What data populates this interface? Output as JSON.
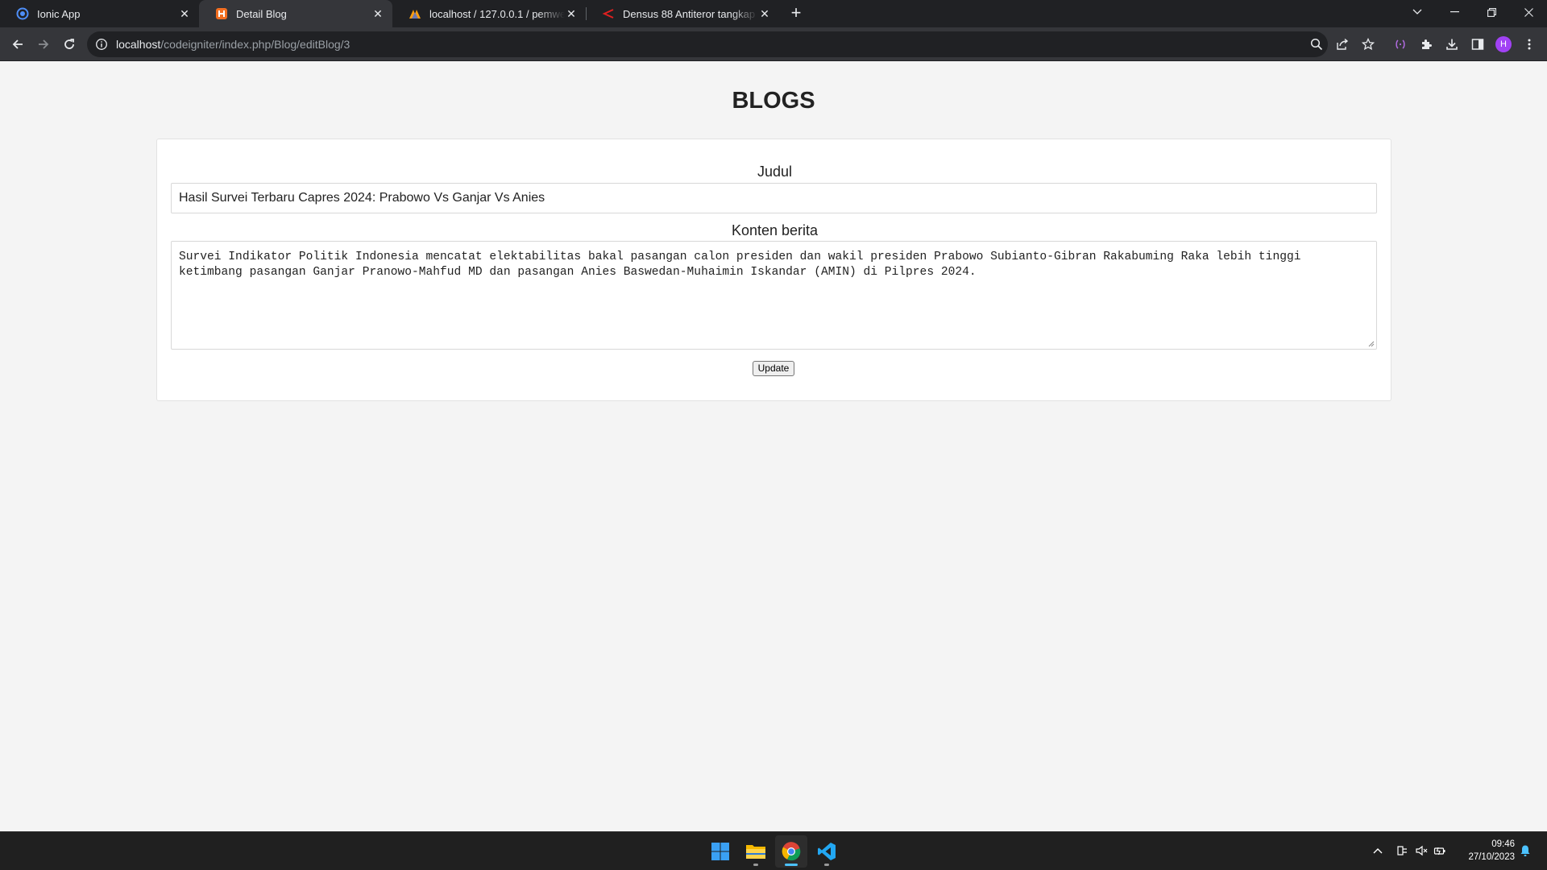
{
  "browser": {
    "tabs": [
      {
        "title": "Ionic App",
        "icon": "ionic-icon",
        "active": false
      },
      {
        "title": "Detail Blog",
        "icon": "codeigniter-icon",
        "active": true
      },
      {
        "title": "localhost / 127.0.0.1 / pemweb /",
        "icon": "phpmyadmin-icon",
        "active": false
      },
      {
        "title": "Densus 88 Antiteror tangkap 18",
        "icon": "news-icon",
        "active": false
      }
    ],
    "address": {
      "host": "localhost",
      "path": "/codeigniter/index.php/Blog/editBlog/3"
    },
    "profile_initial": "H",
    "accent_color": "#a142f4"
  },
  "page": {
    "title": "BLOGS",
    "form": {
      "judul_label": "Judul",
      "judul_value": "Hasil Survei Terbaru Capres 2024: Prabowo Vs Ganjar Vs Anies",
      "konten_label": "Konten berita",
      "konten_value": "Survei Indikator Politik Indonesia mencatat elektabilitas bakal pasangan calon presiden dan wakil presiden Prabowo Subianto-Gibran Rakabuming Raka lebih tinggi\nketimbang pasangan Ganjar Pranowo-Mahfud MD dan pasangan Anies Baswedan-Muhaimin Iskandar (AMIN) di Pilpres 2024.",
      "submit_label": "Update"
    }
  },
  "taskbar": {
    "apps": [
      "windows-start-icon",
      "file-explorer-icon",
      "chrome-icon",
      "vscode-icon"
    ],
    "time": "09:46",
    "date": "27/10/2023"
  }
}
